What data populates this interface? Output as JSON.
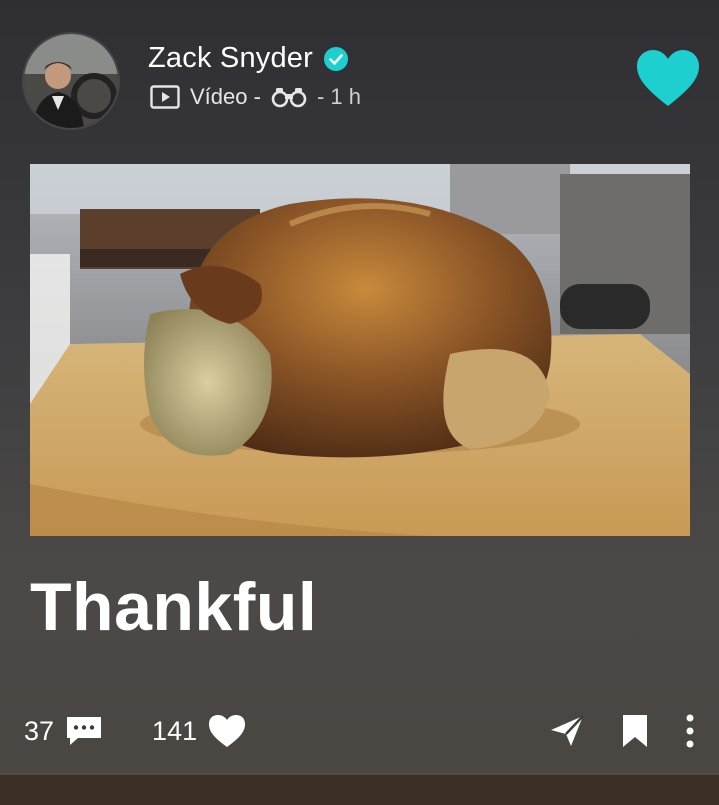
{
  "post": {
    "author": "Zack Snyder",
    "media_type": "Vídeo -",
    "time": "- 1 h",
    "caption": "Thankful",
    "comments_count": "37",
    "likes_count": "141"
  },
  "icons": {
    "verified": "verified-check-icon",
    "video": "video-play-icon",
    "binoculars": "binoculars-icon",
    "like": "heart-icon",
    "comment": "comment-bubble-icon",
    "share": "send-icon",
    "save": "bookmark-icon",
    "more": "more-vertical-icon"
  },
  "colors": {
    "accent": "#1ecfd0",
    "text": "#ffffff"
  }
}
